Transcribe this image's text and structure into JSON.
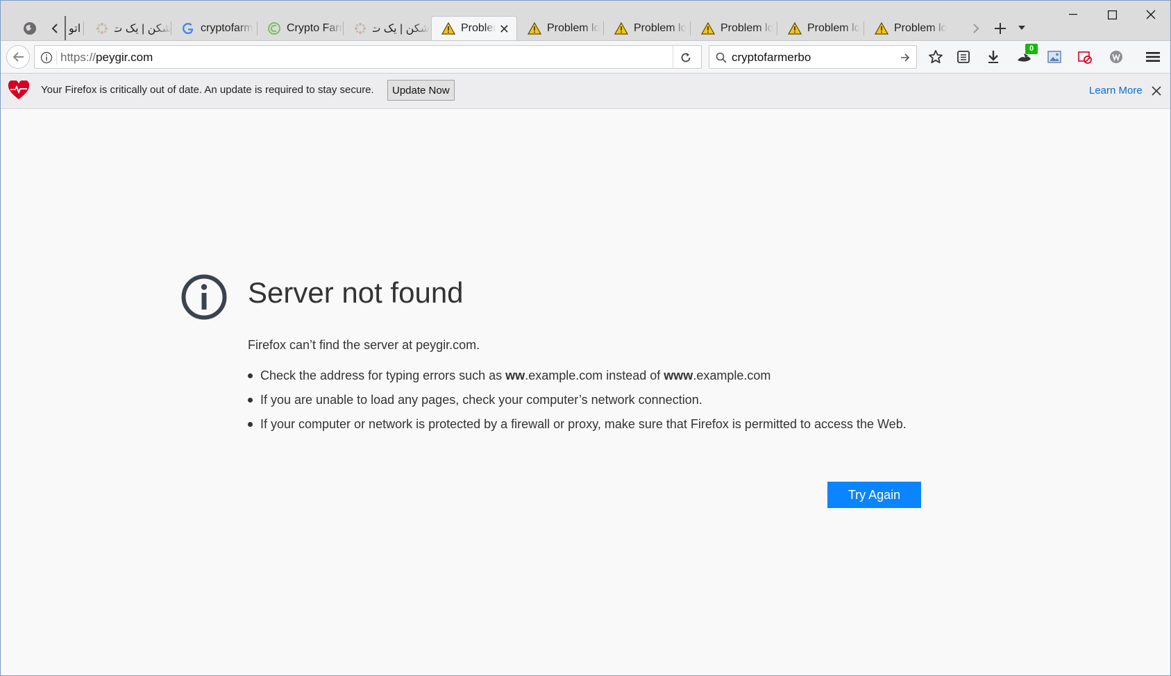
{
  "browser": {
    "tabs": [
      {
        "label": "اتو",
        "icon": "partial-tab",
        "selected": false
      },
      {
        "label": "شکن | یک ت",
        "icon": "site-favicon",
        "selected": false
      },
      {
        "label": "cryptofarm",
        "icon": "google-icon",
        "selected": false
      },
      {
        "label": "Crypto Farr",
        "icon": "crypto-farm-icon",
        "selected": false
      },
      {
        "label": "شکن | یک ت",
        "icon": "site-favicon",
        "selected": false
      },
      {
        "label": "Problem lo",
        "icon": "warning-icon",
        "selected": true
      },
      {
        "label": "Problem lo",
        "icon": "warning-icon",
        "selected": false
      },
      {
        "label": "Problem lo",
        "icon": "warning-icon",
        "selected": false
      },
      {
        "label": "Problem lo",
        "icon": "warning-icon",
        "selected": false
      },
      {
        "label": "Problem lo",
        "icon": "warning-icon",
        "selected": false
      },
      {
        "label": "Problem lo",
        "icon": "warning-icon",
        "selected": false
      }
    ],
    "selected_tab_label": "Probler",
    "url_protocol": "https://",
    "url_host": "peygir.com",
    "search_value": "cryptofarmerbo",
    "badge_count": "0"
  },
  "notification": {
    "message": "Your Firefox is critically out of date. An update is required to stay secure.",
    "update_button": "Update Now",
    "learn_more": "Learn More"
  },
  "error_page": {
    "title": "Server not found",
    "description": "Firefox can’t find the server at peygir.com.",
    "bullets": {
      "b1_prefix": "Check the address for typing errors such as ",
      "b1_bold1": "ww",
      "b1_mid": ".example.com instead of ",
      "b1_bold2": "www",
      "b1_suffix": ".example.com",
      "b2": "If you are unable to load any pages, check your computer’s network connection.",
      "b3": "If your computer or network is protected by a firewall or proxy, make sure that Firefox is permitted to access the Web."
    },
    "try_again": "Try Again"
  },
  "colors": {
    "accent": "#0a84ff",
    "link": "#0a6ccf",
    "warning": "#f5c518",
    "badge": "#12bc00",
    "heart": "#d70022"
  }
}
